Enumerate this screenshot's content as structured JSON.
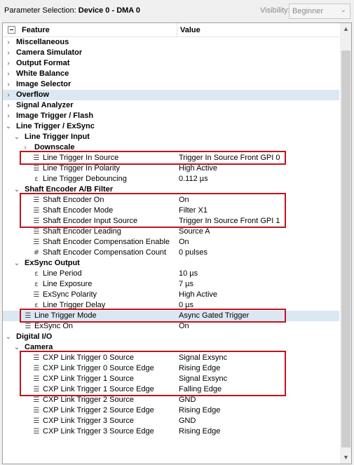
{
  "header": {
    "param_label": "Parameter Selection:",
    "device": "Device 0 - DMA 0",
    "visibility_label": "Visibility:",
    "visibility_value": "Beginner"
  },
  "columns": {
    "feature": "Feature",
    "value": "Value"
  },
  "rows": [
    {
      "level": 0,
      "expander": "closed",
      "icon": "",
      "name": "Miscellaneous",
      "value": "",
      "category": true
    },
    {
      "level": 0,
      "expander": "closed",
      "icon": "",
      "name": "Camera Simulator",
      "value": "",
      "category": true
    },
    {
      "level": 0,
      "expander": "closed",
      "icon": "",
      "name": "Output Format",
      "value": "",
      "category": true
    },
    {
      "level": 0,
      "expander": "closed",
      "icon": "",
      "name": "White Balance",
      "value": "",
      "category": true
    },
    {
      "level": 0,
      "expander": "closed",
      "icon": "",
      "name": "Image Selector",
      "value": "",
      "category": true
    },
    {
      "level": 0,
      "expander": "closed",
      "icon": "",
      "name": "Overflow",
      "value": "",
      "category": true,
      "selected": true
    },
    {
      "level": 0,
      "expander": "closed",
      "icon": "",
      "name": "Signal Analyzer",
      "value": "",
      "category": true
    },
    {
      "level": 0,
      "expander": "closed",
      "icon": "",
      "name": "Image Trigger / Flash",
      "value": "",
      "category": true
    },
    {
      "level": 0,
      "expander": "open",
      "icon": "",
      "name": "Line Trigger / ExSync",
      "value": "",
      "category": true
    },
    {
      "level": 1,
      "expander": "open",
      "icon": "",
      "name": "Line Trigger Input",
      "value": "",
      "category": true
    },
    {
      "level": 2,
      "expander": "closed",
      "icon": "",
      "name": "Downscale",
      "value": "",
      "category": true
    },
    {
      "level": 2,
      "expander": "",
      "icon": "enum",
      "name": "Line Trigger In Source",
      "value": "Trigger In Source Front GPI 0"
    },
    {
      "level": 2,
      "expander": "",
      "icon": "enum",
      "name": "Line Trigger In Polarity",
      "value": "High Active"
    },
    {
      "level": 2,
      "expander": "",
      "icon": "float",
      "name": "Line Trigger Debouncing",
      "value": "0.112 µs"
    },
    {
      "level": 1,
      "expander": "open",
      "icon": "",
      "name": "Shaft Encoder A/B Filter",
      "value": "",
      "category": true
    },
    {
      "level": 2,
      "expander": "",
      "icon": "enum",
      "name": "Shaft Encoder On",
      "value": "On"
    },
    {
      "level": 2,
      "expander": "",
      "icon": "enum",
      "name": "Shaft Encoder Mode",
      "value": "Filter X1"
    },
    {
      "level": 2,
      "expander": "",
      "icon": "enum",
      "name": "Shaft Encoder Input Source",
      "value": "Trigger In Source Front GPI 1"
    },
    {
      "level": 2,
      "expander": "",
      "icon": "enum",
      "name": "Shaft Encoder Leading",
      "value": "Source A"
    },
    {
      "level": 2,
      "expander": "",
      "icon": "enum",
      "name": "Shaft Encoder Compensation Enable",
      "value": "On"
    },
    {
      "level": 2,
      "expander": "",
      "icon": "int",
      "name": "Shaft Encoder Compensation Count",
      "value": "0 pulses"
    },
    {
      "level": 1,
      "expander": "open",
      "icon": "",
      "name": "ExSync Output",
      "value": "",
      "category": true
    },
    {
      "level": 2,
      "expander": "",
      "icon": "float",
      "name": "Line Period",
      "value": "10 µs"
    },
    {
      "level": 2,
      "expander": "",
      "icon": "float",
      "name": "Line Exposure",
      "value": "7 µs"
    },
    {
      "level": 2,
      "expander": "",
      "icon": "enum",
      "name": "ExSync Polarity",
      "value": "High Active"
    },
    {
      "level": 2,
      "expander": "",
      "icon": "float",
      "name": "Line Trigger Delay",
      "value": "0 µs"
    },
    {
      "level": 1,
      "expander": "",
      "icon": "enum",
      "name": "Line Trigger Mode",
      "value": "Async Gated Trigger",
      "selected": true
    },
    {
      "level": 1,
      "expander": "",
      "icon": "enum",
      "name": "ExSync On",
      "value": "On"
    },
    {
      "level": 0,
      "expander": "open",
      "icon": "",
      "name": "Digital I/O",
      "value": "",
      "category": true
    },
    {
      "level": 1,
      "expander": "open",
      "icon": "",
      "name": "Camera",
      "value": "",
      "category": true
    },
    {
      "level": 2,
      "expander": "",
      "icon": "enum",
      "name": "CXP Link Trigger 0 Source",
      "value": "Signal Exsync"
    },
    {
      "level": 2,
      "expander": "",
      "icon": "enum",
      "name": "CXP Link Trigger 0 Source Edge",
      "value": "Rising Edge"
    },
    {
      "level": 2,
      "expander": "",
      "icon": "enum",
      "name": "CXP Link Trigger 1 Source",
      "value": "Signal Exsync"
    },
    {
      "level": 2,
      "expander": "",
      "icon": "enum",
      "name": "CXP Link Trigger 1 Source Edge",
      "value": "Falling Edge"
    },
    {
      "level": 2,
      "expander": "",
      "icon": "enum",
      "name": "CXP Link Trigger 2 Source",
      "value": "GND"
    },
    {
      "level": 2,
      "expander": "",
      "icon": "enum",
      "name": "CXP Link Trigger 2 Source Edge",
      "value": "Rising Edge"
    },
    {
      "level": 2,
      "expander": "",
      "icon": "enum",
      "name": "CXP Link Trigger 3 Source",
      "value": "GND"
    },
    {
      "level": 2,
      "expander": "",
      "icon": "enum",
      "name": "CXP Link Trigger 3 Source Edge",
      "value": "Rising Edge"
    }
  ],
  "highlights": [
    {
      "first": 11,
      "last": 11
    },
    {
      "first": 15,
      "last": 17
    },
    {
      "first": 26,
      "last": 26
    },
    {
      "first": 30,
      "last": 33
    }
  ],
  "colors": {
    "highlight": "#c0141c",
    "selection": "#dbe7f3"
  }
}
